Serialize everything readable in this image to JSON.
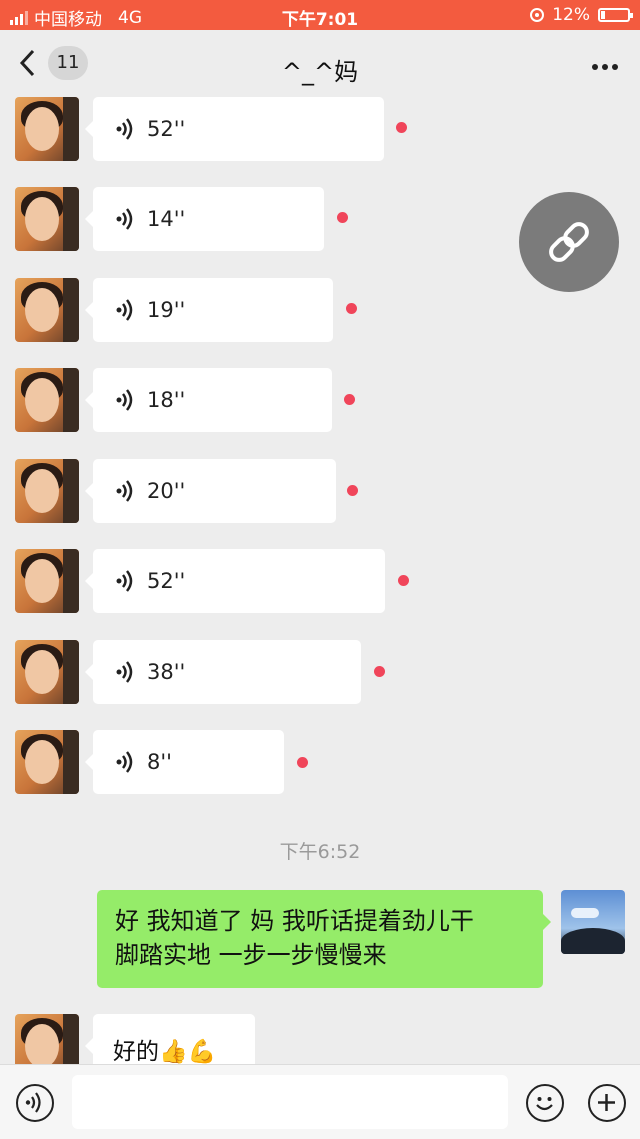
{
  "status_bar": {
    "carrier": "中国移动",
    "network": "4G",
    "time": "下午7:01",
    "battery": "12%"
  },
  "nav": {
    "unread_count": "11",
    "title": "^_^妈"
  },
  "voice_messages": [
    {
      "duration": "52''"
    },
    {
      "duration": "14''"
    },
    {
      "duration": "19''"
    },
    {
      "duration": "18''"
    },
    {
      "duration": "20''"
    },
    {
      "duration": "52''"
    },
    {
      "duration": "38''"
    },
    {
      "duration": "8''"
    }
  ],
  "timestamp": "下午6:52",
  "self_message": {
    "line1": "好 我知道了 妈 我听话提着劲儿干",
    "line2": "脚踏实地 一步一步慢慢来"
  },
  "reply_message": {
    "text": "好的",
    "emoji": "👍💪"
  },
  "icons": {
    "back": "chevron-left-icon",
    "more": "more-dots-icon",
    "voice": "voice-wave-icon",
    "link": "link-icon",
    "emoji": "emoji-icon",
    "add": "plus-icon"
  },
  "colors": {
    "status_bar": "#f35b3f",
    "self_bubble": "#95ec69",
    "unread_dot": "#f0455a"
  }
}
